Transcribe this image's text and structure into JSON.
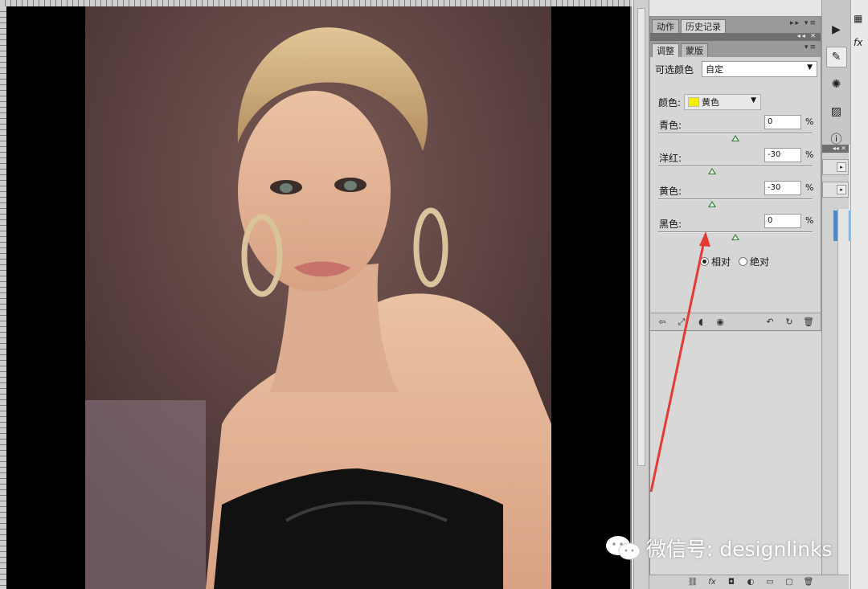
{
  "panel": {
    "tabs": [
      {
        "label": "动作",
        "active": false
      },
      {
        "label": "历史记录",
        "active": true
      }
    ],
    "subtabs": [
      {
        "label": "调整",
        "active": true
      },
      {
        "label": "蒙版",
        "active": false
      }
    ],
    "preset_label": "可选颜色",
    "preset_value": "自定",
    "color_label": "颜色:",
    "color_value": "黄色",
    "color_swatch": "#f2f000",
    "sliders": [
      {
        "label": "青色:",
        "value": "0",
        "unit": "%",
        "fraction": 0.5
      },
      {
        "label": "洋红:",
        "value": "-30",
        "unit": "%",
        "fraction": 0.35
      },
      {
        "label": "黄色:",
        "value": "-30",
        "unit": "%",
        "fraction": 0.35
      },
      {
        "label": "黑色:",
        "value": "0",
        "unit": "%",
        "fraction": 0.5
      }
    ],
    "method_options": [
      {
        "label": "相对",
        "selected": true
      },
      {
        "label": "绝对",
        "selected": false
      }
    ]
  },
  "watermark": {
    "text": "微信号: designlinks"
  },
  "icons": {
    "dock": [
      "play-icon",
      "brush-settings-icon",
      "compass-icon",
      "image-icon",
      "info-icon"
    ],
    "panel_footer": [
      "back-arrow-icon",
      "expand-icon",
      "clip-icon",
      "eye-icon",
      "previous-state-icon",
      "reset-icon",
      "delete-icon"
    ],
    "layers_footer": [
      "link-icon",
      "fx-icon",
      "mask-icon",
      "adjustment-icon",
      "group-icon",
      "new-layer-icon",
      "trash-icon"
    ]
  },
  "colors": {
    "annotation_arrow": "#e53a36",
    "selection_blue": "#3e8fd9",
    "slider_handle": "#2f7d2f"
  }
}
